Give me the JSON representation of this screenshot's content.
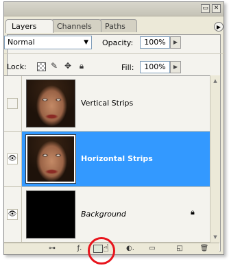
{
  "panel": {
    "tabs": [
      {
        "label": "Layers"
      },
      {
        "label": "Channels"
      },
      {
        "label": "Paths"
      }
    ],
    "blend_mode": "Normal",
    "opacity_label": "Opacity:",
    "opacity_value": "100%",
    "lock_label": "Lock:",
    "fill_label": "Fill:",
    "fill_value": "100%"
  },
  "layers": [
    {
      "name": "Vertical Strips",
      "visible": false,
      "selected": false
    },
    {
      "name": "Horizontal Strips",
      "visible": true,
      "selected": true
    },
    {
      "name": "Background",
      "visible": true,
      "selected": false,
      "locked": true
    }
  ],
  "colors": {
    "selection": "#3399ff",
    "highlight_circle": "#e8141c",
    "panel_bg": "#ece9d8"
  },
  "icons": {
    "eye": "eye-icon",
    "lock": "lock-icon",
    "add_mask": "layer-mask-icon"
  }
}
